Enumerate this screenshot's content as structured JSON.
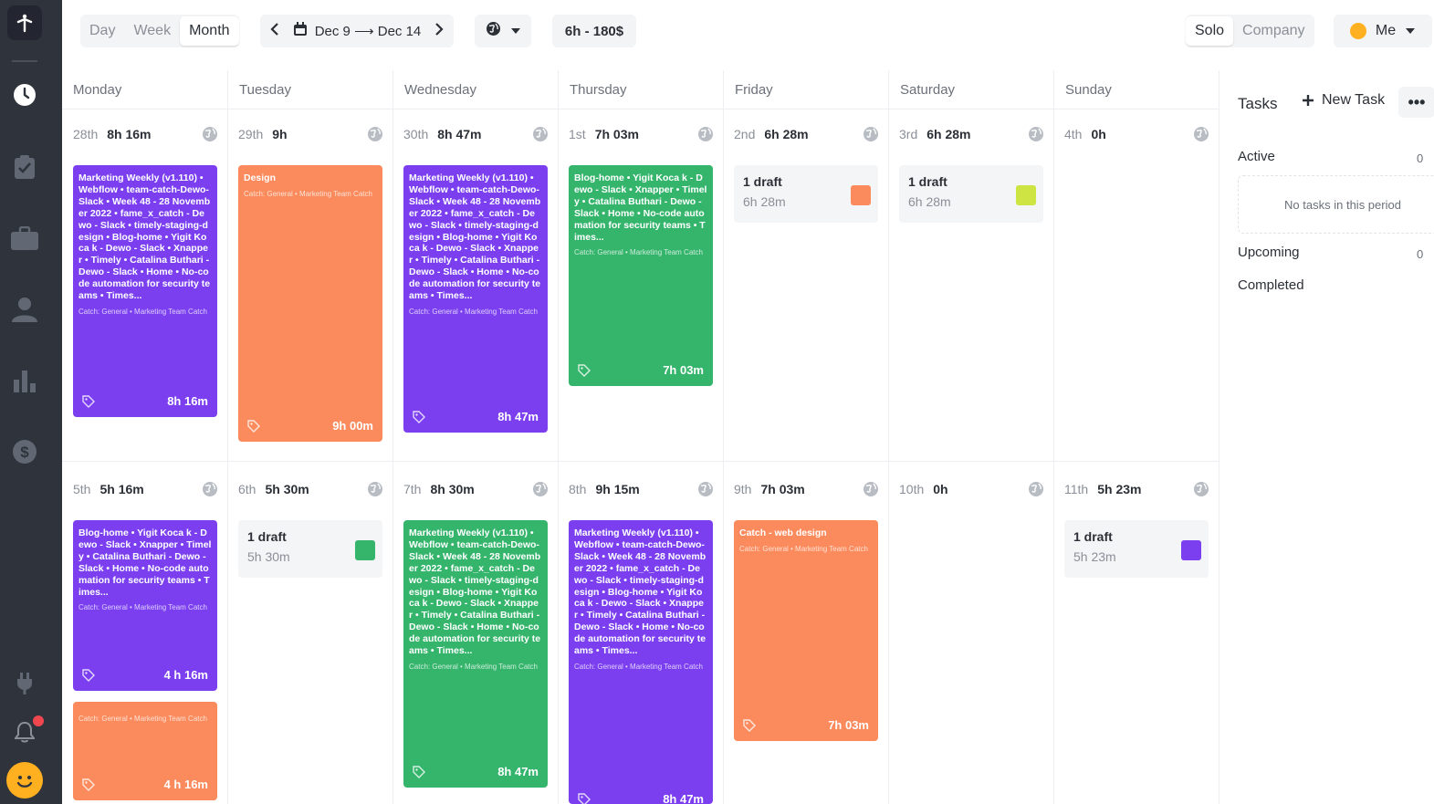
{
  "colors": {
    "sidebar": "#2f333b",
    "purple": "#7b3ff0",
    "orange": "#fb8a5c",
    "green": "#35b56c",
    "lime": "#cde443"
  },
  "toolbar": {
    "views": [
      "Day",
      "Week",
      "Month"
    ],
    "active_view": "Month",
    "range": "Dec 9 ⟶ Dec 14",
    "summary": "6h - 180$",
    "modes": [
      "Solo",
      "Company"
    ],
    "user": "Me"
  },
  "days": [
    "Monday",
    "Tuesday",
    "Wednesday",
    "Thursday",
    "Friday",
    "Saturday",
    "Sunday"
  ],
  "weeks": [
    {
      "cells": [
        {
          "date": "28th",
          "hours": "8h 16m"
        },
        {
          "date": "29th",
          "hours": "9h"
        },
        {
          "date": "30th",
          "hours": "8h 47m"
        },
        {
          "date": "1st",
          "hours": "7h 03m"
        },
        {
          "date": "2nd",
          "hours": "6h 28m"
        },
        {
          "date": "3rd",
          "hours": "6h 28m"
        },
        {
          "date": "4th",
          "hours": "0h"
        }
      ]
    },
    {
      "cells": [
        {
          "date": "5th",
          "hours": "5h 16m"
        },
        {
          "date": "6th",
          "hours": "5h 30m"
        },
        {
          "date": "7th",
          "hours": "8h 30m"
        },
        {
          "date": "8th",
          "hours": "9h 15m"
        },
        {
          "date": "9th",
          "hours": "7h 03m"
        },
        {
          "date": "10th",
          "hours": "0h"
        },
        {
          "date": "11th",
          "hours": "5h 23m"
        }
      ]
    }
  ],
  "cards": {
    "c1": {
      "title": "Marketing Weekly (v1.110) • Webflow • team-catch-Dewo-Slack • Week 48 - 28 November 2022 • fame_x_catch - Dewo - Slack • timely-staging-design • Blog-home • Yigit Koca k - Dewo - Slack • Xnapper • Timely • Catalina Buthari - Dewo - Slack • Home • No-code automation for security teams • Times...",
      "tags": "Catch: General • Marketing Team Catch",
      "duration": "8h 16m"
    },
    "c2": {
      "title": "Design",
      "tags": "Catch: General • Marketing Team Catch",
      "duration": "9h 00m"
    },
    "c3": {
      "title": "Marketing Weekly (v1.110) • Webflow • team-catch-Dewo-Slack • Week 48 - 28 November 2022 • fame_x_catch - Dewo - Slack • timely-staging-design • Blog-home • Yigit Koca k - Dewo - Slack • Xnapper • Timely • Catalina Buthari - Dewo - Slack • Home • No-code automation for security teams • Times...",
      "tags": "Catch: General • Marketing Team Catch",
      "duration": "8h 47m"
    },
    "c4": {
      "title": "Blog-home • Yigit Koca k - Dewo - Slack • Xnapper • Timely • Catalina Buthari - Dewo - Slack • Home • No-code automation for security teams • Times...",
      "tags": "Catch: General • Marketing Team Catch",
      "duration": "7h 03m"
    },
    "c5": {
      "title": "Blog-home • Yigit Koca k - Dewo - Slack • Xnapper • Timely • Catalina Buthari - Dewo - Slack • Home • No-code automation for security teams • Times...",
      "tags": "Catch: General • Marketing Team Catch",
      "duration": "4 h 16m"
    },
    "c6": {
      "title": "",
      "tags": "Catch: General • Marketing Team Catch",
      "duration": "4 h 16m"
    },
    "c7": {
      "title": "Marketing Weekly (v1.110) • Webflow • team-catch-Dewo-Slack • Week 48 - 28 November 2022 • fame_x_catch - Dewo - Slack • timely-staging-design • Blog-home • Yigit Koca k - Dewo - Slack • Xnapper • Timely • Catalina Buthari - Dewo - Slack • Home • No-code automation for security teams • Times...",
      "tags": "Catch: General • Marketing Team Catch",
      "duration": "8h 47m"
    },
    "c8": {
      "title": "Marketing Weekly (v1.110) • Webflow • team-catch-Dewo-Slack • Week 48 - 28 November 2022 • fame_x_catch - Dewo - Slack • timely-staging-design • Blog-home • Yigit Koca k - Dewo - Slack • Xnapper • Timely • Catalina Buthari - Dewo - Slack • Home • No-code automation for security teams • Times...",
      "tags": "Catch: General • Marketing Team Catch",
      "duration": "8h 47m"
    },
    "c9": {
      "title": "Catch - web design",
      "tags": "Catch: General • Marketing Team Catch",
      "duration": "7h 03m"
    }
  },
  "drafts": {
    "fri": {
      "title": "1 draft",
      "time": "6h 28m"
    },
    "sat": {
      "title": "1 draft",
      "time": "6h 28m"
    },
    "tue2": {
      "title": "1 draft",
      "time": "5h 30m"
    },
    "sun2": {
      "title": "1 draft",
      "time": "5h 23m"
    }
  },
  "tasks": {
    "title": "Tasks",
    "new_task": "New Task",
    "active": "Active",
    "active_count": "0",
    "empty": "No tasks in this period",
    "upcoming": "Upcoming",
    "upcoming_count": "0",
    "completed": "Completed"
  },
  "icons": [
    "logo-icon",
    "clock-icon",
    "clipboard-check-icon",
    "briefcase-icon",
    "user-icon",
    "bar-chart-icon",
    "dollar-icon",
    "plug-icon",
    "bell-icon",
    "avatar-face",
    "calendar-icon",
    "globe-icon",
    "tag-icon",
    "plus-icon",
    "more-icon"
  ]
}
